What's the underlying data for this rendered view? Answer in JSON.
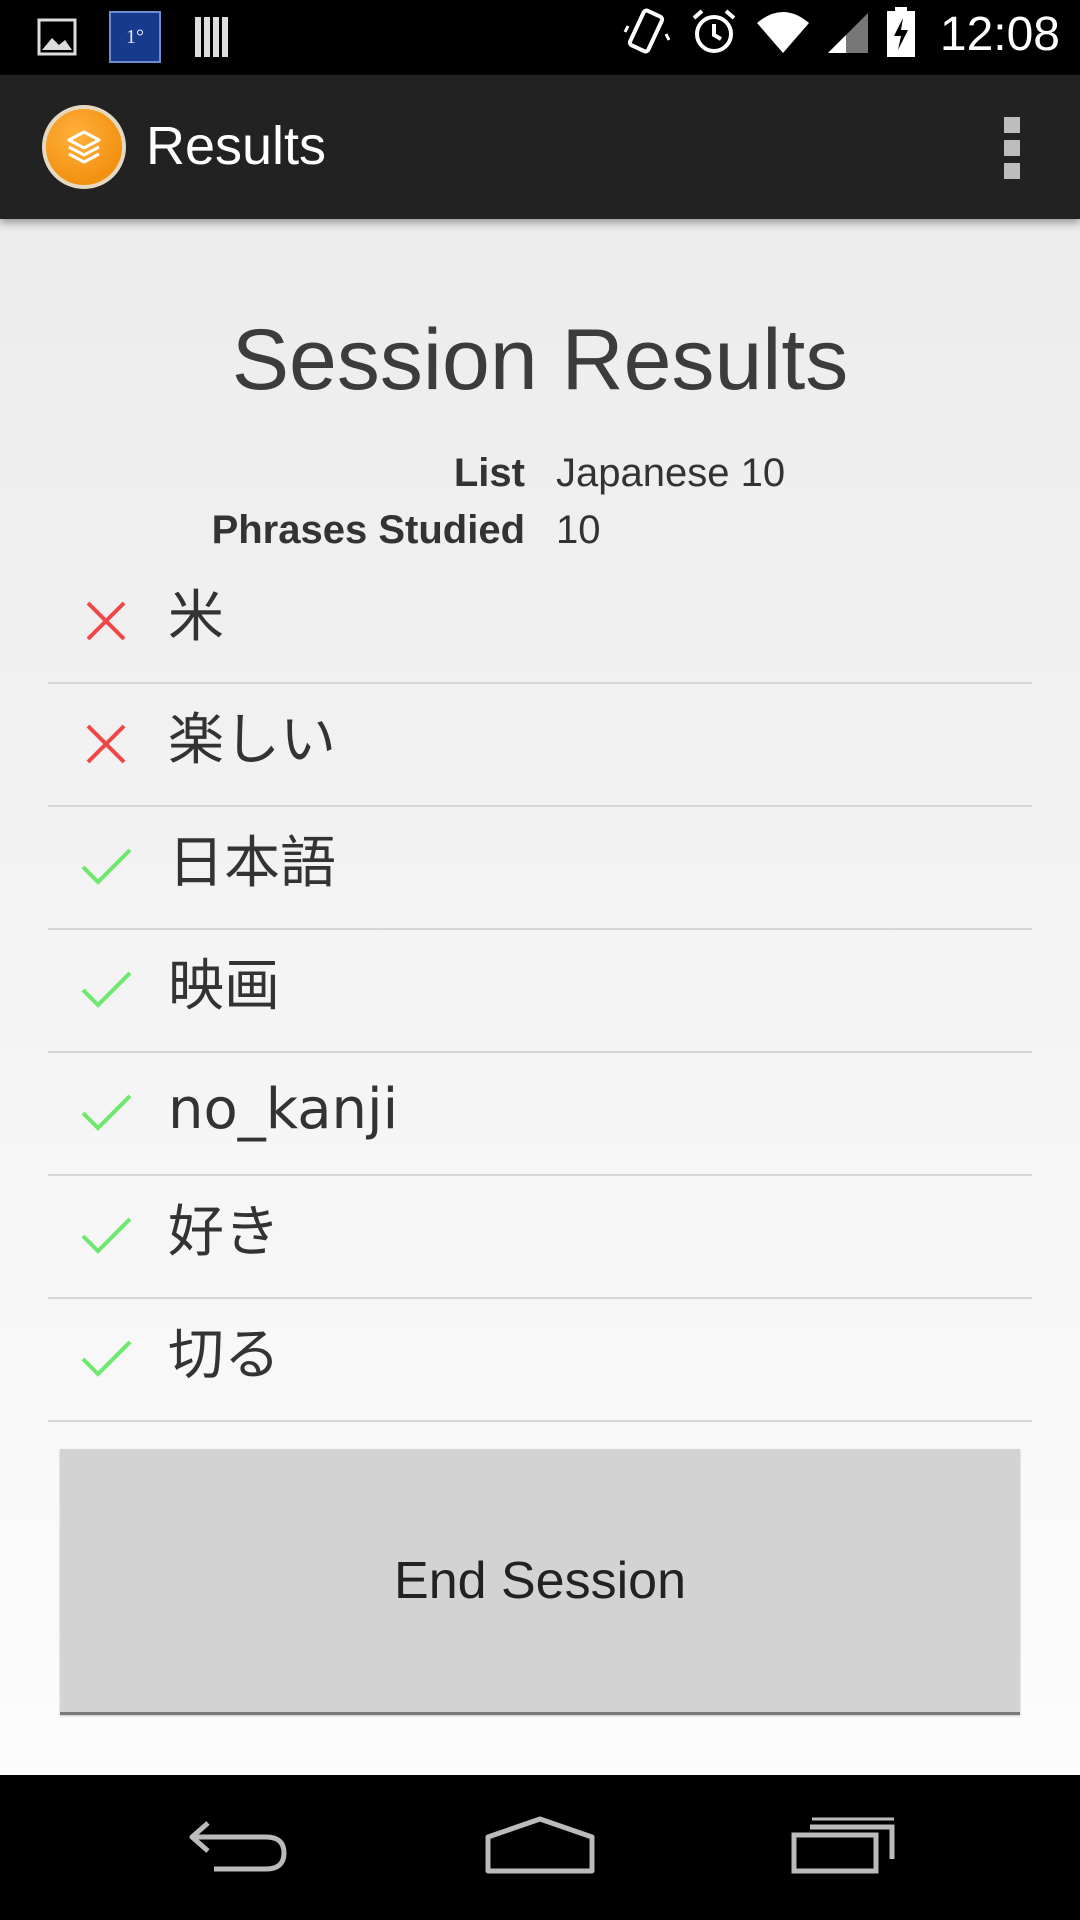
{
  "status_bar": {
    "time": "12:08",
    "weather_label": "1°",
    "colors": {
      "text": "#ffffff"
    }
  },
  "action_bar": {
    "title": "Results",
    "app_icon": "layers-icon",
    "overflow_icon": "overflow-menu-icon"
  },
  "main": {
    "title": "Session Results",
    "info": [
      {
        "label": "List",
        "value": "Japanese 10"
      },
      {
        "label": "Phrases Studied",
        "value": "10"
      }
    ],
    "phrases": [
      {
        "text": "米",
        "result": "incorrect",
        "icon": "cross-icon"
      },
      {
        "text": "楽しい",
        "result": "incorrect",
        "icon": "cross-icon"
      },
      {
        "text": "日本語",
        "result": "correct",
        "icon": "check-icon"
      },
      {
        "text": "映画",
        "result": "correct",
        "icon": "check-icon"
      },
      {
        "text": "no_kanji",
        "result": "correct",
        "icon": "check-icon"
      },
      {
        "text": "好き",
        "result": "correct",
        "icon": "check-icon"
      },
      {
        "text": "切る",
        "result": "correct",
        "icon": "check-icon"
      }
    ],
    "end_button_label": "End Session"
  },
  "colors": {
    "incorrect": "#f04646",
    "correct": "#6ee86e",
    "action_bar": "#222222",
    "accent": "#f39111"
  },
  "nav_bar": {
    "back_icon": "back-icon",
    "home_icon": "home-icon",
    "recents_icon": "recents-icon"
  }
}
